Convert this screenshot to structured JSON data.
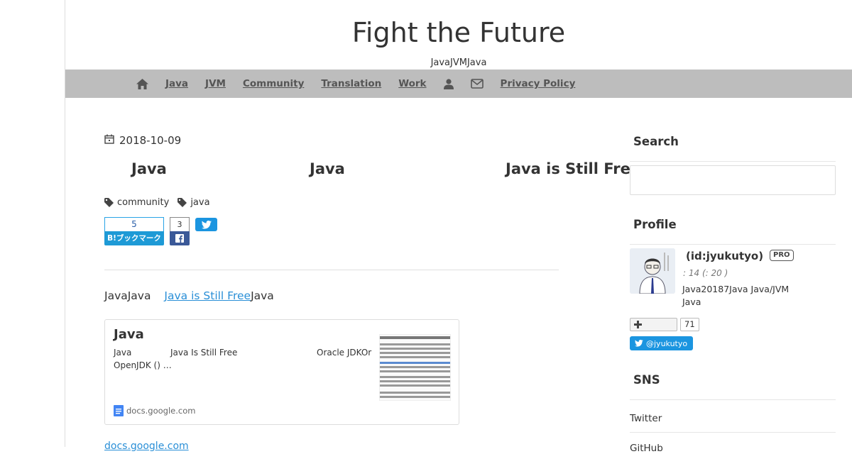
{
  "header": {
    "title": "Fight the Future",
    "description": "JavaJVMJava"
  },
  "nav": {
    "items": [
      {
        "icon": "home-icon"
      },
      {
        "label": "Java"
      },
      {
        "label": "JVM"
      },
      {
        "label": "Community"
      },
      {
        "label": "Translation"
      },
      {
        "label": "Work"
      },
      {
        "icon": "person-icon"
      },
      {
        "icon": "mail-icon"
      },
      {
        "label": "Privacy Policy"
      }
    ]
  },
  "entry": {
    "date": "2018-10-09",
    "title_parts": [
      "Java",
      "Java",
      "Java is Still Free"
    ],
    "tags": [
      "community",
      "java"
    ],
    "hatena_count": "5",
    "hatena_label": "B!ブックマーク",
    "facebook_count": "3",
    "intro_prefix": "JavaJava",
    "intro_link": "Java is Still Free",
    "intro_suffix": "Java",
    "card": {
      "title": "Java",
      "desc_line1_a": "Java",
      "desc_line1_b": "Java Is Still Free",
      "desc_line1_c": "Oracle JDKOr",
      "desc_line2": "OpenJDK () …",
      "source": "docs.google.com"
    },
    "link_below": "docs.google.com"
  },
  "sidebar": {
    "search_title": "Search",
    "profile_title": "Profile",
    "profile_id": "(id:jyukutyo)",
    "pro_badge": "PRO",
    "profile_meta": ":        14 (:        20 )",
    "profile_bio_1": "Java20187Java Java/JVM",
    "profile_bio_2": "Java",
    "reader_count": "71",
    "twitter_handle": "@jyukutyo",
    "sns_title": "SNS",
    "sns_items": [
      "Twitter",
      "GitHub"
    ]
  },
  "colors": {
    "nav_bg": "#bdbdbd",
    "link": "#2a8fd7",
    "hatena_blue": "#1e9ad6",
    "facebook_blue": "#3b5998",
    "twitter_blue": "#1b95e0"
  }
}
